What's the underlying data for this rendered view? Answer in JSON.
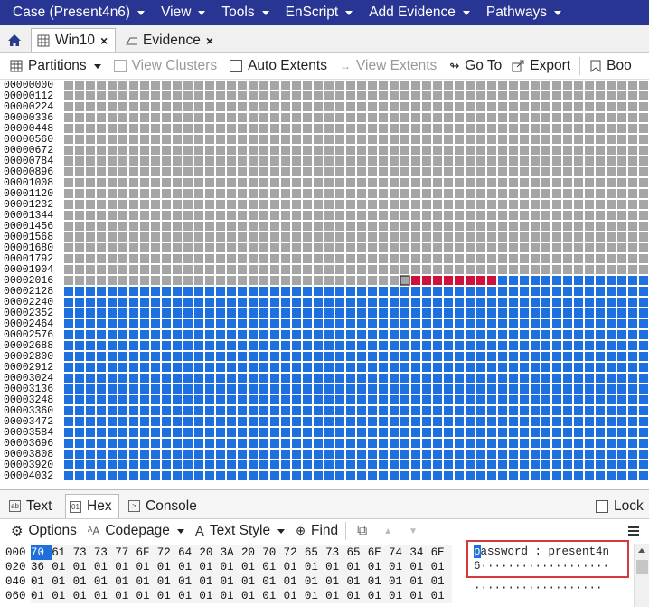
{
  "menubar": {
    "case": "Case (Present4n6)",
    "view": "View",
    "tools": "Tools",
    "enscript": "EnScript",
    "add_evidence": "Add Evidence",
    "pathways": "Pathways",
    "bg_color": "#283593"
  },
  "tabs": [
    {
      "label": "Win10",
      "active": true
    },
    {
      "label": "Evidence",
      "active": false
    }
  ],
  "toolbar": {
    "partitions": "Partitions",
    "view_clusters": "View Clusters",
    "auto_extents": "Auto Extents",
    "view_extents": "View Extents",
    "go_to": "Go To",
    "export": "Export",
    "bookmark": "Boo"
  },
  "offsets": [
    "00000000",
    "00000112",
    "00000224",
    "00000336",
    "00000448",
    "00000560",
    "00000672",
    "00000784",
    "00000896",
    "00001008",
    "00001120",
    "00001232",
    "00001344",
    "00001456",
    "00001568",
    "00001680",
    "00001792",
    "00001904",
    "00002016",
    "00002128",
    "00002240",
    "00002352",
    "00002464",
    "00002576",
    "00002688",
    "00002800",
    "00002912",
    "00003024",
    "00003136",
    "00003248",
    "00003360",
    "00003472",
    "00003584",
    "00003696",
    "00003808",
    "00003920",
    "00004032"
  ],
  "disk_view": {
    "colors": {
      "empty": "#a5a5a5",
      "used": "#1e6fe0",
      "highlight": "#d0103a",
      "border": "#ffffff"
    },
    "columns": 54,
    "rows": 37,
    "gray_rows": 18,
    "row18": {
      "gray_until": 31,
      "selected_index": 31,
      "red_start": 32,
      "red_end": 39
    },
    "blue_from_row": 19
  },
  "bottom_tabs": {
    "text": "Text",
    "hex": "Hex",
    "console": "Console",
    "lock": "Lock"
  },
  "hex_toolbar": {
    "options": "Options",
    "codepage": "Codepage",
    "text_style": "Text Style",
    "find": "Find"
  },
  "hex_rows": [
    {
      "offset": "000",
      "bytes": [
        "70",
        "61",
        "73",
        "73",
        "77",
        "6F",
        "72",
        "64",
        "20",
        "3A",
        "20",
        "70",
        "72",
        "65",
        "73",
        "65",
        "6E",
        "74",
        "34",
        "6E"
      ]
    },
    {
      "offset": "020",
      "bytes": [
        "36",
        "01",
        "01",
        "01",
        "01",
        "01",
        "01",
        "01",
        "01",
        "01",
        "01",
        "01",
        "01",
        "01",
        "01",
        "01",
        "01",
        "01",
        "01",
        "01"
      ]
    },
    {
      "offset": "040",
      "bytes": [
        "01",
        "01",
        "01",
        "01",
        "01",
        "01",
        "01",
        "01",
        "01",
        "01",
        "01",
        "01",
        "01",
        "01",
        "01",
        "01",
        "01",
        "01",
        "01",
        "01"
      ]
    },
    {
      "offset": "060",
      "bytes": [
        "01",
        "01",
        "01",
        "01",
        "01",
        "01",
        "01",
        "01",
        "01",
        "01",
        "01",
        "01",
        "01",
        "01",
        "01",
        "01",
        "01",
        "01",
        "01",
        "01"
      ]
    }
  ],
  "text_pane": {
    "first_char": "p",
    "line1_rest": "assword : present4n",
    "line2": "6···················",
    "line3": "···················"
  }
}
